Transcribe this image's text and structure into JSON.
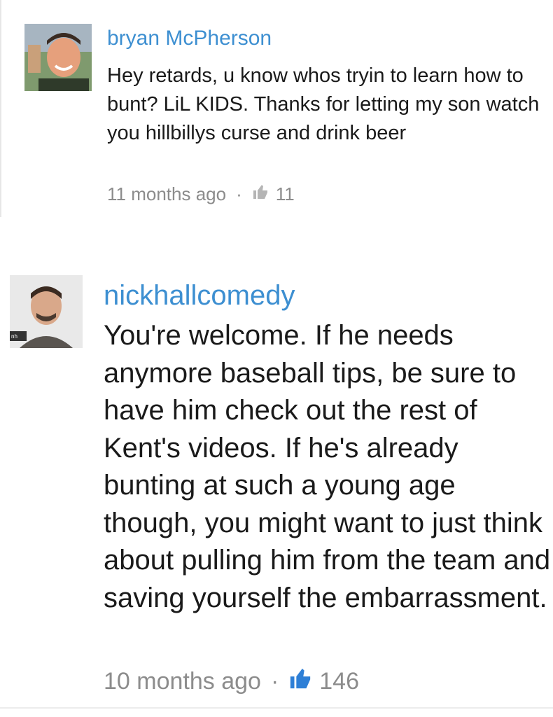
{
  "comments": [
    {
      "username": "bryan McPherson",
      "text": "Hey retards, u know whos tryin to learn how to bunt? LiL KIDS. Thanks for letting my son watch you hillbillys curse and drink beer",
      "time": "11 months ago",
      "separator": "·",
      "likes": "11",
      "like_icon": "thumbs-up-icon",
      "like_color": "#b5b5b5"
    },
    {
      "username": "nickhallcomedy",
      "text": "You're welcome. If he needs anymore baseball tips, be sure to have him check out the rest of Kent's videos. If he's already bunting at such a young age though, you might want to just think about pulling him from the team and saving yourself the embarrassment.",
      "time": "10 months ago",
      "separator": "·",
      "likes": "146",
      "like_icon": "thumbs-up-icon",
      "like_color": "#2e7fd6"
    }
  ],
  "colors": {
    "username": "#3d8fd1",
    "text": "#1a1a1a",
    "meta": "#8c8c8c"
  }
}
